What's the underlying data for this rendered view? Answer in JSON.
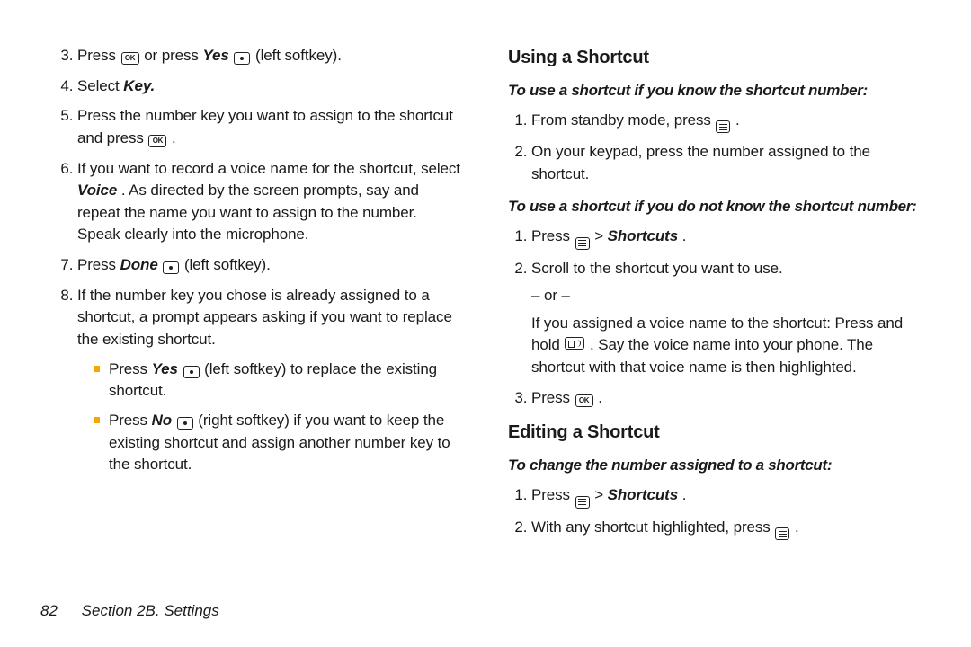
{
  "left": {
    "li3_a": "Press ",
    "li3_b": " or press ",
    "li3_yes": "Yes",
    "li3_c": " (left softkey).",
    "li4_a": "Select ",
    "li4_key": "Key.",
    "li5_a": "Press the number key you want to assign to the shortcut and press ",
    "li5_b": ".",
    "li6_a": "If you want to record a voice name for the shortcut, select ",
    "li6_voice": "Voice",
    "li6_b": ". As directed by the screen prompts, say and repeat the name you want to assign to the number. Speak clearly into the microphone.",
    "li7_a": "Press ",
    "li7_done": "Done",
    "li7_b": " (left softkey).",
    "li8_a": "If the number key you chose is already assigned to a shortcut, a prompt appears asking if you want to replace the existing shortcut.",
    "li8_sub1_a": "Press ",
    "li8_sub1_yes": "Yes",
    "li8_sub1_b": " (left softkey) to replace the existing shortcut.",
    "li8_sub2_a": "Press ",
    "li8_sub2_no": "No",
    "li8_sub2_b": " (right softkey) if you want to keep the existing shortcut and assign another number key to the shortcut."
  },
  "right": {
    "h_using": "Using a Shortcut",
    "p_known": "To use a shortcut if you know the shortcut number:",
    "k1_a": "From standby mode, press ",
    "k1_b": ".",
    "k2": "On your keypad, press the number assigned to the shortcut.",
    "p_unknown": "To use a shortcut if you do not know the shortcut number:",
    "u1_a": "Press ",
    "u1_gt": " > ",
    "u1_sc": "Shortcuts",
    "u1_b": ".",
    "u2_a": "Scroll to the shortcut you want to use.",
    "u2_or": "– or –",
    "u2_b": "If you assigned a voice name to the shortcut: Press and hold ",
    "u2_c": ". Say the voice name into your phone. The shortcut with that voice name is then highlighted.",
    "u3_a": "Press ",
    "u3_b": ".",
    "h_editing": "Editing a Shortcut",
    "p_change": "To change the number assigned to a shortcut:",
    "e1_a": "Press ",
    "e1_gt": " > ",
    "e1_sc": "Shortcuts",
    "e1_b": ".",
    "e2_a": "With any shortcut highlighted, press ",
    "e2_b": "."
  },
  "footer": {
    "page": "82",
    "section": "Section 2B. Settings"
  },
  "icons": {
    "ok_label": "OK"
  }
}
